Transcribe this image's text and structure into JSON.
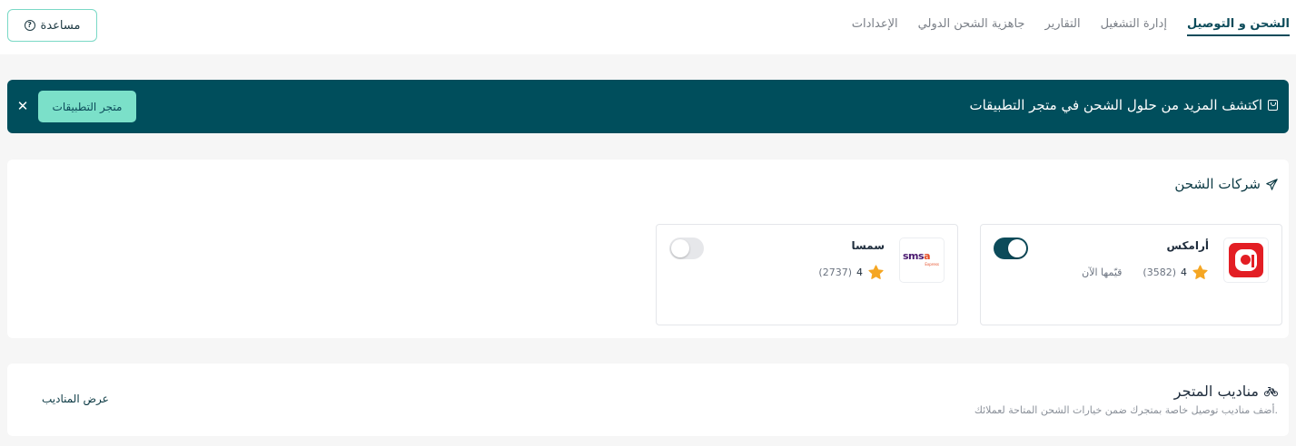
{
  "nav": {
    "tabs": [
      {
        "label": "الشحن و التوصيل",
        "active": true
      },
      {
        "label": "إدارة التشغيل",
        "active": false
      },
      {
        "label": "التقارير",
        "active": false
      },
      {
        "label": "جاهزية الشحن الدولي",
        "active": false
      },
      {
        "label": "الإعدادات",
        "active": false
      }
    ],
    "help_label": "مساعدة",
    "help_icon": "question-circle-icon"
  },
  "banner": {
    "text": "اكتشف المزيد من حلول الشحن في متجر التطبيقات",
    "icon": "store-bag-icon",
    "button_label": "متجر التطبيقات",
    "close_icon": "close-icon",
    "background": "#004e5c",
    "button_color": "#7be0c9"
  },
  "carriers_section": {
    "title": "شركات الشحن",
    "icon": "plane-icon",
    "items": [
      {
        "name": "أرامكس",
        "rating": "4",
        "reviews": "(3582)",
        "rate_link": "قيّمها الآن",
        "enabled": true,
        "logo": "aramex-logo"
      },
      {
        "name": "سمسا",
        "rating": "4",
        "reviews": "(2737)",
        "enabled": false,
        "logo": "smsa-logo"
      }
    ],
    "logo_text": {
      "smsa_main": "sms",
      "smsa_accent": "a",
      "smsa_sub": "Express"
    }
  },
  "couriers_section": {
    "title": "مناديب المتجر",
    "icon": "bike-icon",
    "description": "أضف مناديب توصيل خاصة بمتجرك ضمن خيارات الشحن المتاحة لعملائك.",
    "link_label": "عرض المناديب"
  },
  "colors": {
    "primary": "#0c4b5a",
    "accent": "#7ad9c6",
    "star": "#f5a623",
    "aramex_red": "#e31e24"
  }
}
